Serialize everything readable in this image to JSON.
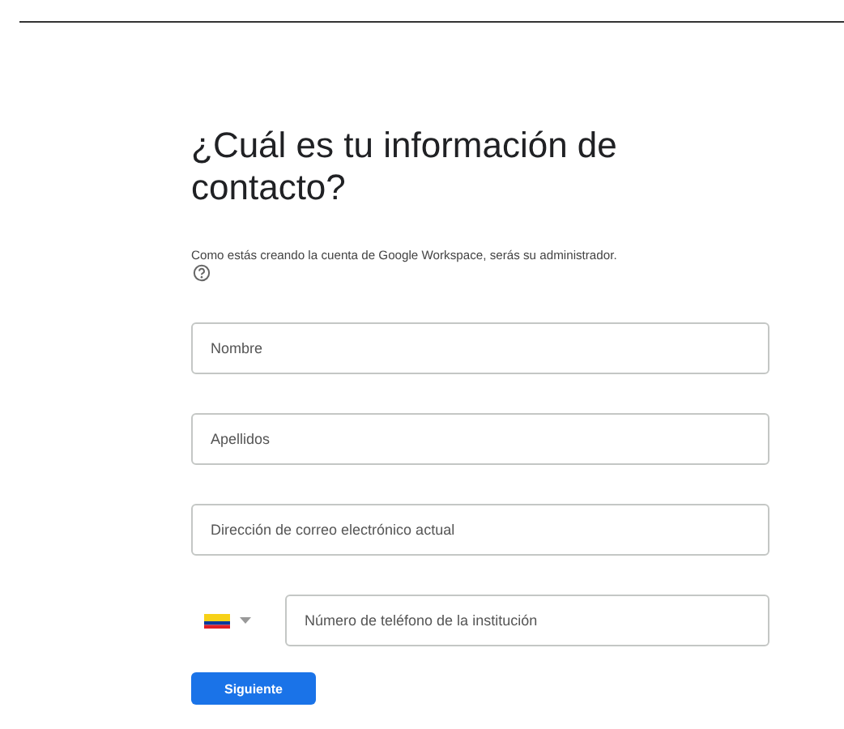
{
  "title": "¿Cuál es tu información de contacto?",
  "description": "Como estás creando la cuenta de Google Workspace, serás su administrador.",
  "fields": [
    {
      "placeholder": "Nombre"
    },
    {
      "placeholder": "Apellidos"
    },
    {
      "placeholder": "Dirección de correo electrónico actual"
    }
  ],
  "phone": {
    "placeholder": "Número de teléfono de la institución"
  },
  "buttons": [
    "Siguiente"
  ]
}
